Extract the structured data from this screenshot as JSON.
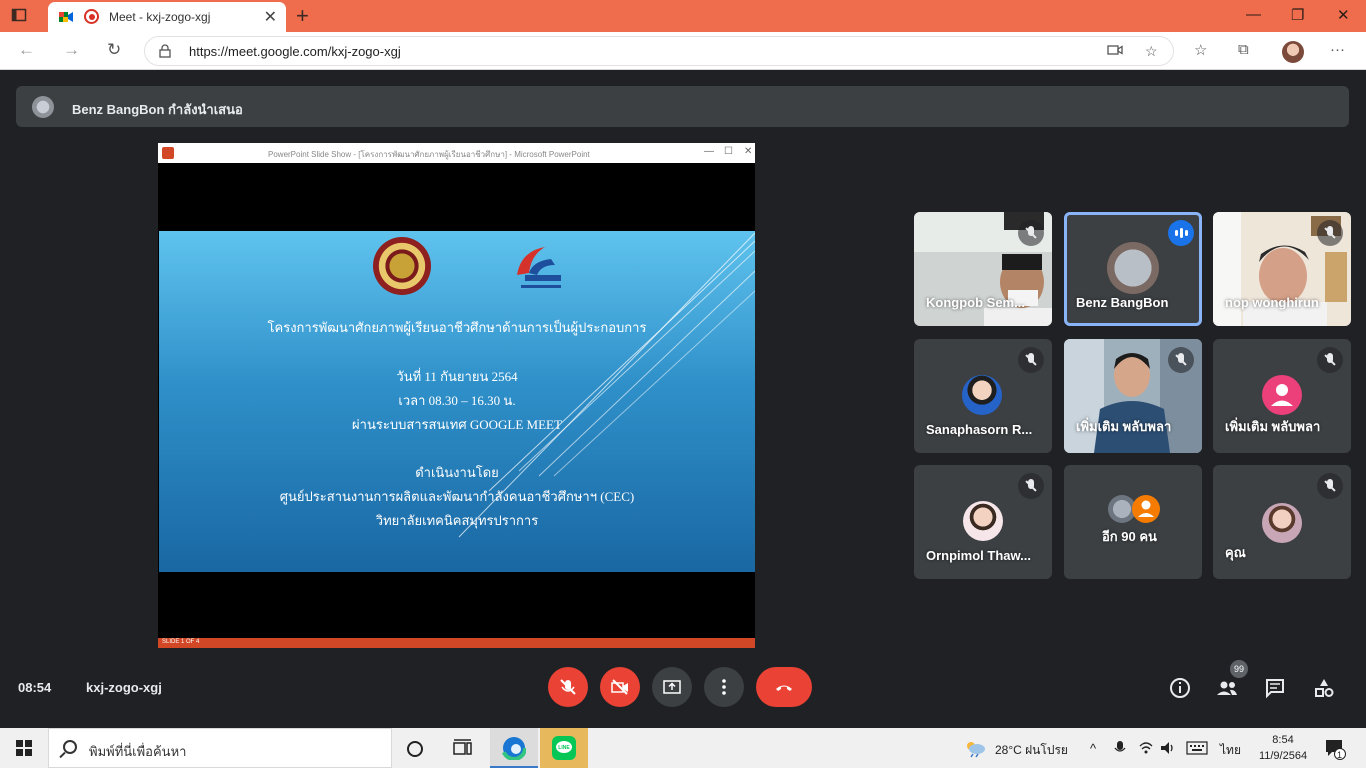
{
  "browser": {
    "tab_title": "Meet - kxj-zogo-xgj",
    "url": "https://meet.google.com/kxj-zogo-xgj"
  },
  "presenting": {
    "text": "Benz BangBon กำลังนำเสนอ"
  },
  "ppt": {
    "caption": "PowerPoint Slide Show - [โครงการพัฒนาศักยภาพผู้เรียนอาชีวศึกษา] - Microsoft PowerPoint",
    "status": "SLIDE 1 OF 4",
    "slide": {
      "line1": "โครงการพัฒนาศักยภาพผู้เรียนอาชีวศึกษาด้านการเป็นผู้ประกอบการ",
      "line2": "วันที่ 11 กันยายน 2564",
      "line3": "เวลา 08.30 – 16.30 น.",
      "line4": "ผ่านระบบสารสนเทศ GOOGLE MEET",
      "line5": "ดำเนินงานโดย",
      "line6": "ศูนย์ประสานงานการผลิตและพัฒนากำลังคนอาชีวศึกษาฯ (CEC)",
      "line7": "วิทยาลัยเทคนิคสมุทรปราการ"
    }
  },
  "participants": [
    {
      "name": "Kongpob Sem..."
    },
    {
      "name": "Benz BangBon"
    },
    {
      "name": "nop wonghirun"
    },
    {
      "name": "Sanaphasorn R..."
    },
    {
      "name": "เพิ่มเติม พลับพลา"
    },
    {
      "name": "เพิ่มเติม พลับพลา"
    },
    {
      "name": "Ornpimol Thaw..."
    },
    {
      "name": "อีก 90 คน"
    },
    {
      "name": "คุณ"
    }
  ],
  "bottom": {
    "time": "08:54",
    "code": "kxj-zogo-xgj",
    "people_badge": "99"
  },
  "taskbar": {
    "search_placeholder": "พิมพ์ที่นี่เพื่อค้นหา",
    "weather": "28°C  ฝนโปรย",
    "lang": "ไทย",
    "time": "8:54",
    "date": "11/9/2564",
    "notif": "1"
  },
  "colors": {
    "titlebar": "#ef6c4c",
    "meet_bg": "#202124",
    "danger": "#ea4335",
    "speaking": "#1a73e8"
  }
}
